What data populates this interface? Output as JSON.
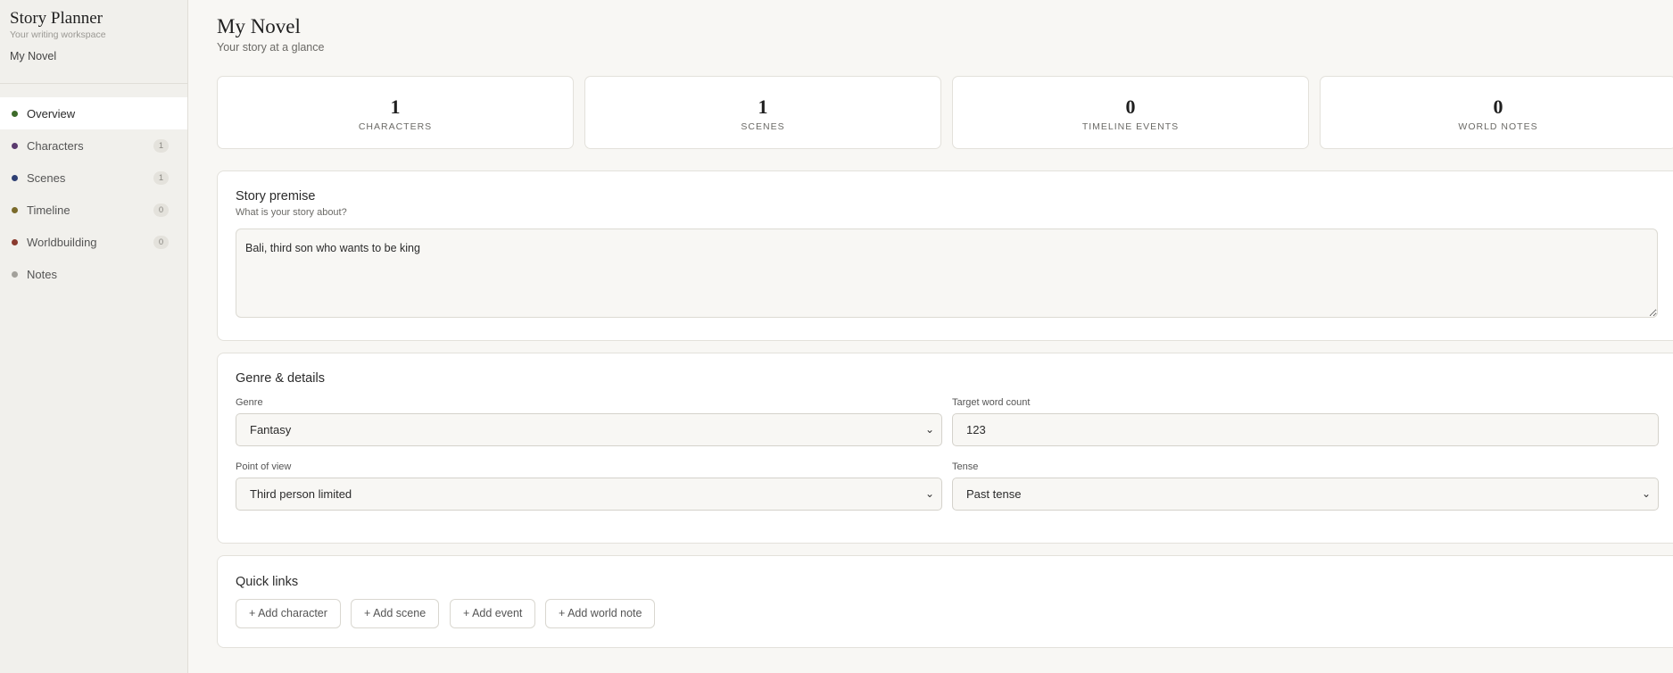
{
  "sidebar": {
    "app_title": "Story Planner",
    "app_subtitle": "Your writing workspace",
    "project_name": "My Novel",
    "items": [
      {
        "label": "Overview",
        "count": null,
        "color": "#3d6b2a"
      },
      {
        "label": "Characters",
        "count": "1",
        "color": "#5a3a6e"
      },
      {
        "label": "Scenes",
        "count": "1",
        "color": "#2e3f73"
      },
      {
        "label": "Timeline",
        "count": "0",
        "color": "#7a6a2a"
      },
      {
        "label": "Worldbuilding",
        "count": "0",
        "color": "#8a3a2e"
      },
      {
        "label": "Notes",
        "count": null,
        "color": "#a3a19b"
      }
    ]
  },
  "header": {
    "title": "My Novel",
    "subtitle": "Your story at a glance"
  },
  "stats": [
    {
      "value": "1",
      "label": "CHARACTERS"
    },
    {
      "value": "1",
      "label": "SCENES"
    },
    {
      "value": "0",
      "label": "TIMELINE EVENTS"
    },
    {
      "value": "0",
      "label": "WORLD NOTES"
    }
  ],
  "premise": {
    "title": "Story premise",
    "subtitle": "What is your story about?",
    "value": "Bali, third son who wants to be king"
  },
  "details": {
    "title": "Genre & details",
    "genre_label": "Genre",
    "genre_value": "Fantasy",
    "word_count_label": "Target word count",
    "word_count_value": "123",
    "pov_label": "Point of view",
    "pov_value": "Third person limited",
    "tense_label": "Tense",
    "tense_value": "Past tense"
  },
  "quick_links": {
    "title": "Quick links",
    "buttons": [
      "+ Add character",
      "+ Add scene",
      "+ Add event",
      "+ Add world note"
    ]
  },
  "icons": {
    "select_chevron": "chevron-down-icon"
  }
}
